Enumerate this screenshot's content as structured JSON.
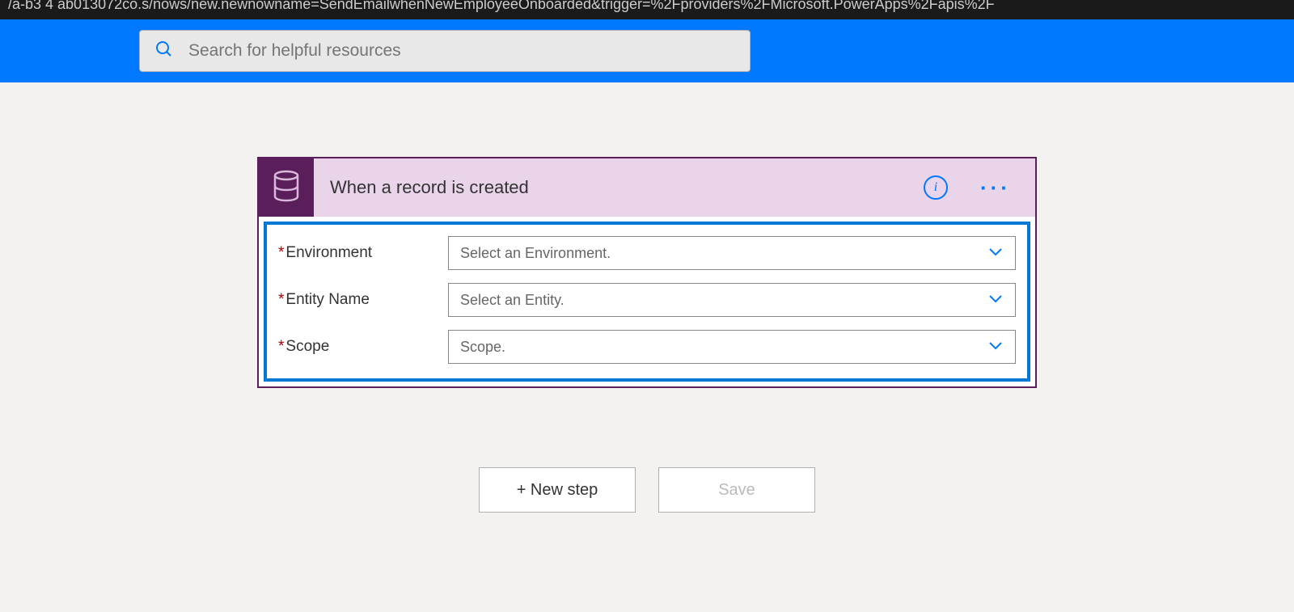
{
  "urlBar": "/a-b3 4 ab013072co.s/nows/new.newnowname=SendEmailwhenNewEmployeeOnboarded&trigger=%2Fproviders%2FMicrosoft.PowerApps%2Fapis%2F",
  "search": {
    "placeholder": "Search for helpful resources"
  },
  "triggerCard": {
    "title": "When a record is created",
    "fields": [
      {
        "label": "Environment",
        "required": true,
        "placeholder": "Select an Environment."
      },
      {
        "label": "Entity Name",
        "required": true,
        "placeholder": "Select an Entity."
      },
      {
        "label": "Scope",
        "required": true,
        "placeholder": "Scope."
      }
    ]
  },
  "buttons": {
    "newStep": "+ New step",
    "save": "Save"
  }
}
